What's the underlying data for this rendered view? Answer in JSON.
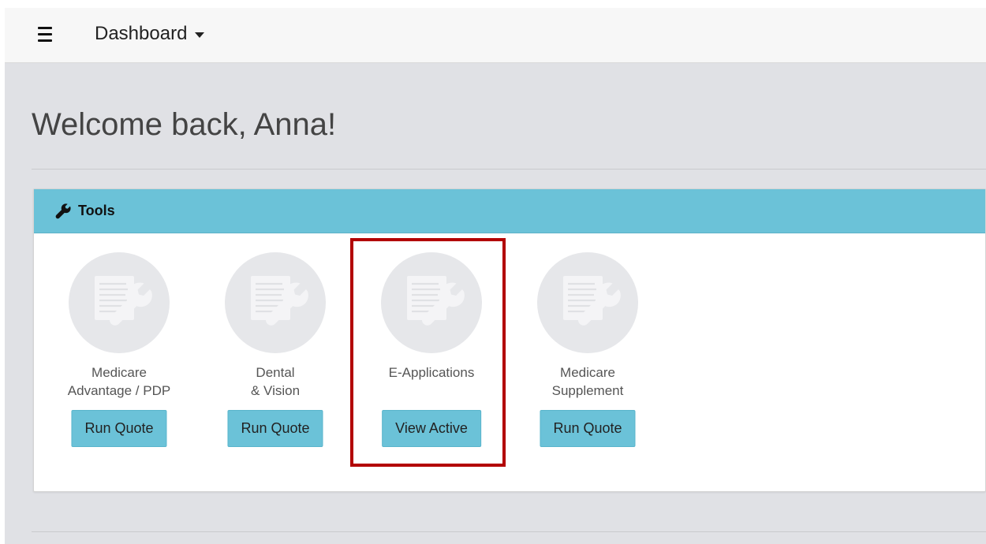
{
  "header": {
    "menu_icon": "hamburger-icon",
    "dashboard_label": "Dashboard",
    "dropdown_icon": "caret-down-icon"
  },
  "main": {
    "welcome_text": "Welcome back, Anna!"
  },
  "tools_panel": {
    "title": "Tools",
    "title_icon": "wrench-icon",
    "accent_color": "#6bc2d8",
    "items": [
      {
        "name_line1": "Medicare",
        "name_line2": "Advantage / PDP",
        "button_label": "Run Quote",
        "icon": "document-wrench-icon"
      },
      {
        "name_line1": "Dental",
        "name_line2": "& Vision",
        "button_label": "Run Quote",
        "icon": "document-wrench-icon"
      },
      {
        "name_line1": "E-Applications",
        "name_line2": "",
        "button_label": "View Active",
        "icon": "document-wrench-icon"
      },
      {
        "name_line1": "Medicare",
        "name_line2": "Supplement",
        "button_label": "Run Quote",
        "icon": "document-wrench-icon"
      }
    ]
  },
  "annotation": {
    "highlight_color": "#b20000",
    "highlighted_item": "E-Applications"
  }
}
